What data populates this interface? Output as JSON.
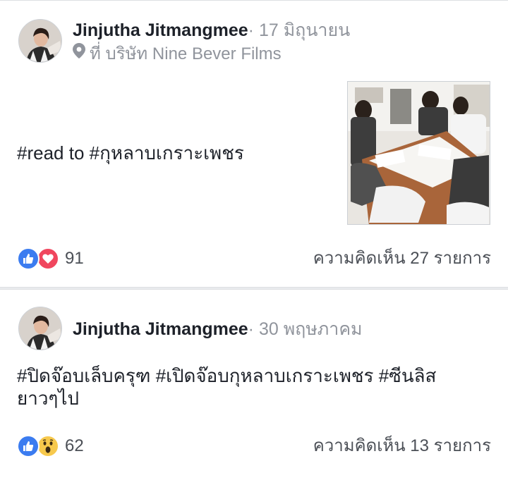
{
  "posts": [
    {
      "author": "Jinjutha Jitmangmee",
      "separator": "·",
      "date": "17 มิถุนายน",
      "location": "ที่ บริษัท Nine Bever Films",
      "text": "#read to #กุหลาบเกราะเพชร",
      "reaction_icons": [
        "like-icon",
        "love-icon"
      ],
      "reaction_count": "91",
      "comments": "ความคิดเห็น 27 รายการ"
    },
    {
      "author": "Jinjutha Jitmangmee",
      "separator": "·",
      "date": "30 พฤษภาคม",
      "text": "#ปิดจ๊อบเล็บครุฑ #เปิดจ๊อบกุหลาบเกราะเพชร #ซีนลิส ยาวๆไป",
      "reaction_icons": [
        "like-icon",
        "wow-icon"
      ],
      "reaction_count": "62",
      "comments": "ความคิดเห็น 13 รายการ"
    }
  ],
  "colors": {
    "like": "#3b7cf0",
    "love": "#f0465e",
    "wow": "#f7c94d",
    "meta_text": "#90949c",
    "primary_text": "#1d2129"
  }
}
